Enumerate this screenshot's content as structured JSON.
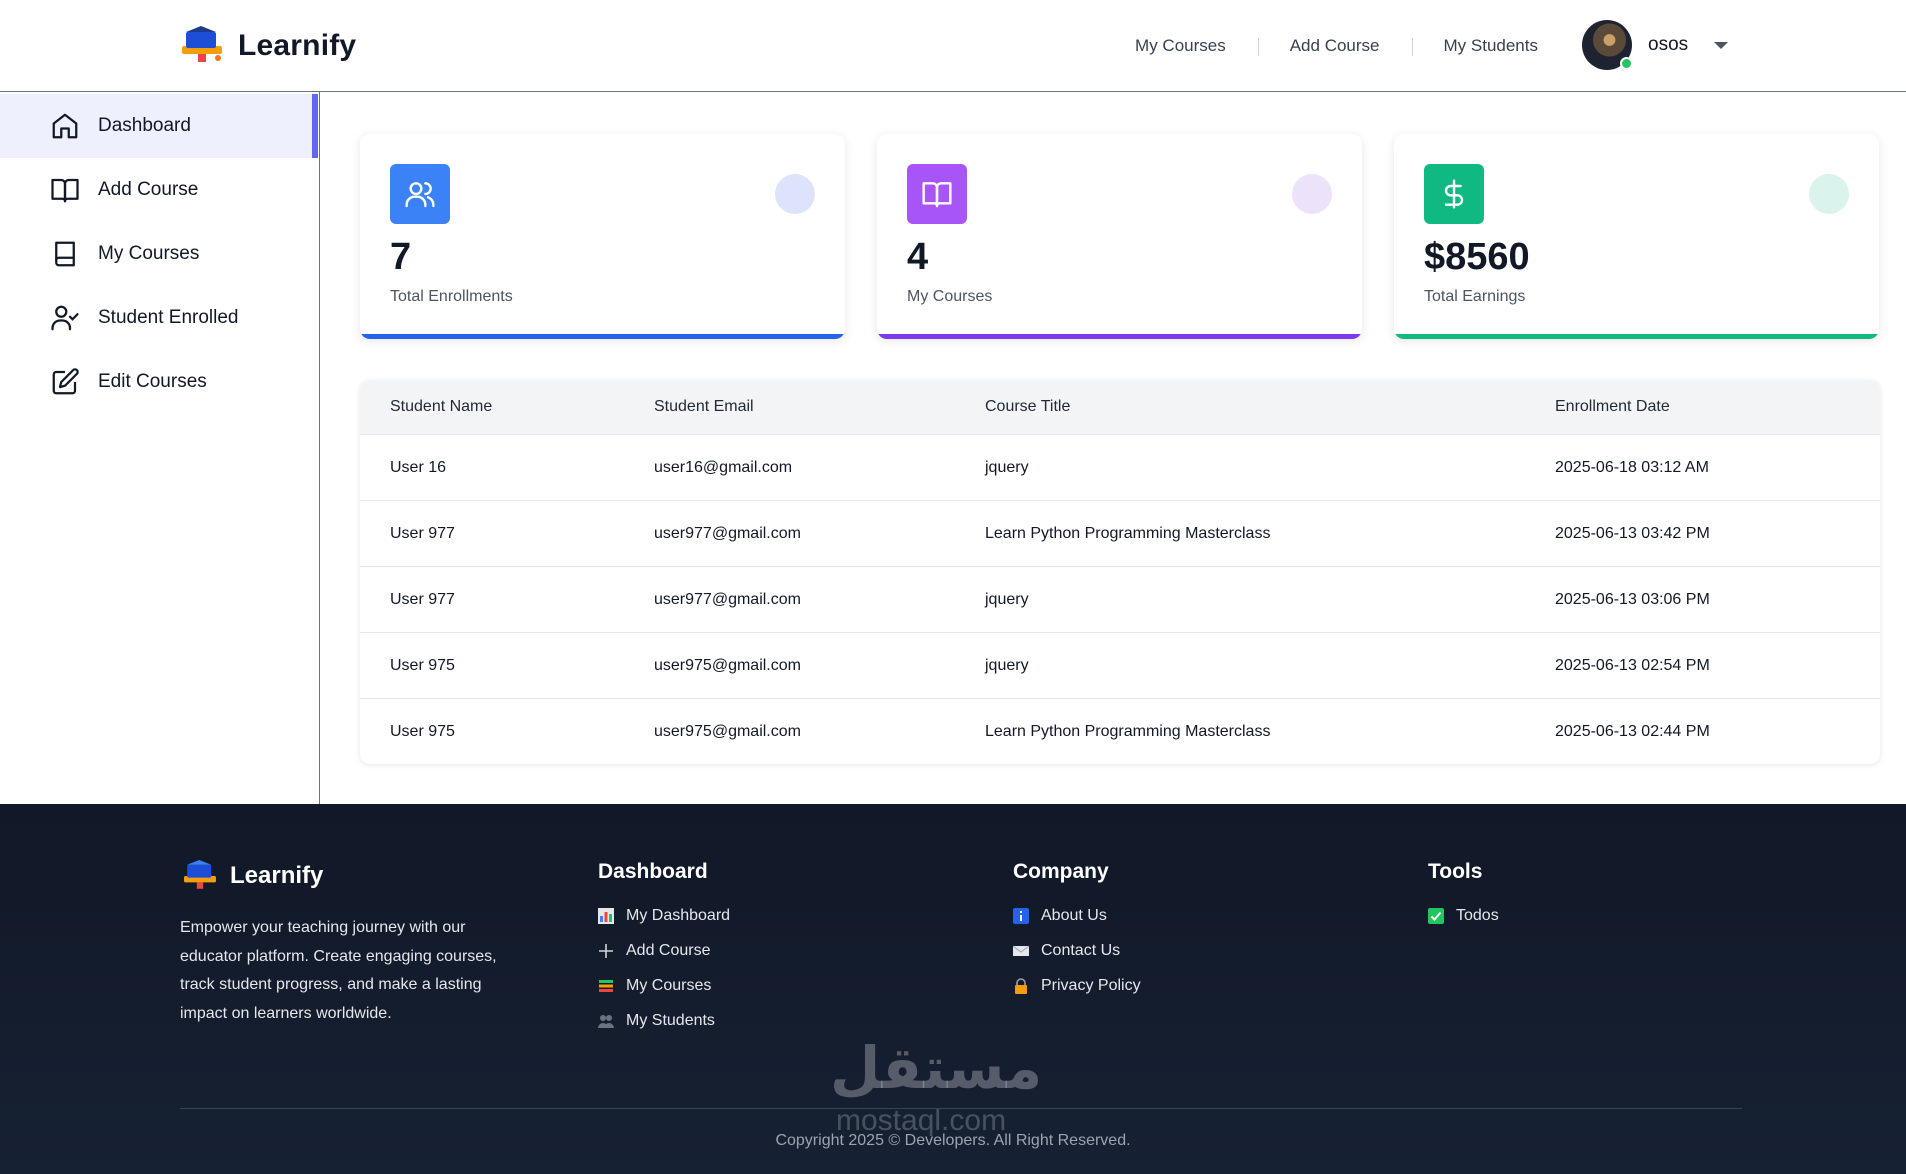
{
  "brand": {
    "name": "Learnify"
  },
  "top_nav": {
    "links": [
      "My Courses",
      "Add Course",
      "My Students"
    ],
    "username": "osos"
  },
  "sidebar": {
    "items": [
      {
        "label": "Dashboard",
        "icon": "home-icon",
        "active": true
      },
      {
        "label": "Add Course",
        "icon": "open-book-icon",
        "active": false
      },
      {
        "label": "My Courses",
        "icon": "book-icon",
        "active": false
      },
      {
        "label": "Student Enrolled",
        "icon": "user-check-icon",
        "active": false
      },
      {
        "label": "Edit Courses",
        "icon": "edit-icon",
        "active": false
      }
    ]
  },
  "stats": [
    {
      "value": "7",
      "label": "Total Enrollments",
      "icon": "users-icon",
      "color": "#3b82f6",
      "dot_color": "#dde3fb",
      "bar_color": "#2563eb"
    },
    {
      "value": "4",
      "label": "My Courses",
      "icon": "open-book-icon",
      "color": "#a855f7",
      "dot_color": "#ece3fb",
      "bar_color": "#7c3aed"
    },
    {
      "value": "$8560",
      "label": "Total Earnings",
      "icon": "dollar-icon",
      "color": "#10b981",
      "dot_color": "#daf3ec",
      "bar_color": "#10b981"
    }
  ],
  "table": {
    "headers": [
      "Student Name",
      "Student Email",
      "Course Title",
      "Enrollment Date"
    ],
    "rows": [
      [
        "User 16",
        "user16@gmail.com",
        "jquery",
        "2025-06-18 03:12 AM"
      ],
      [
        "User 977",
        "user977@gmail.com",
        "Learn Python Programming Masterclass",
        "2025-06-13 03:42 PM"
      ],
      [
        "User 977",
        "user977@gmail.com",
        "jquery",
        "2025-06-13 03:06 PM"
      ],
      [
        "User 975",
        "user975@gmail.com",
        "jquery",
        "2025-06-13 02:54 PM"
      ],
      [
        "User 975",
        "user975@gmail.com",
        "Learn Python Programming Masterclass",
        "2025-06-13 02:44 PM"
      ]
    ]
  },
  "footer": {
    "brand": "Learnify",
    "description": "Empower your teaching journey with our educator platform. Create engaging courses, track student progress, and make a lasting impact on learners worldwide.",
    "columns": [
      {
        "title": "Dashboard",
        "links": [
          {
            "label": "My Dashboard",
            "icon": "bar-chart-icon"
          },
          {
            "label": "Add Course",
            "icon": "plus-icon"
          },
          {
            "label": "My Courses",
            "icon": "books-icon"
          },
          {
            "label": "My Students",
            "icon": "people-icon"
          }
        ]
      },
      {
        "title": "Company",
        "links": [
          {
            "label": "About Us",
            "icon": "info-icon"
          },
          {
            "label": "Contact Us",
            "icon": "envelope-icon"
          },
          {
            "label": "Privacy Policy",
            "icon": "lock-icon"
          }
        ]
      },
      {
        "title": "Tools",
        "links": [
          {
            "label": "Todos",
            "icon": "checkbox-icon"
          }
        ]
      }
    ],
    "copyright": "Copyright 2025 © Developers. All Right Reserved.",
    "watermark": "مستقل",
    "watermark_sub": "mostaql.com"
  }
}
